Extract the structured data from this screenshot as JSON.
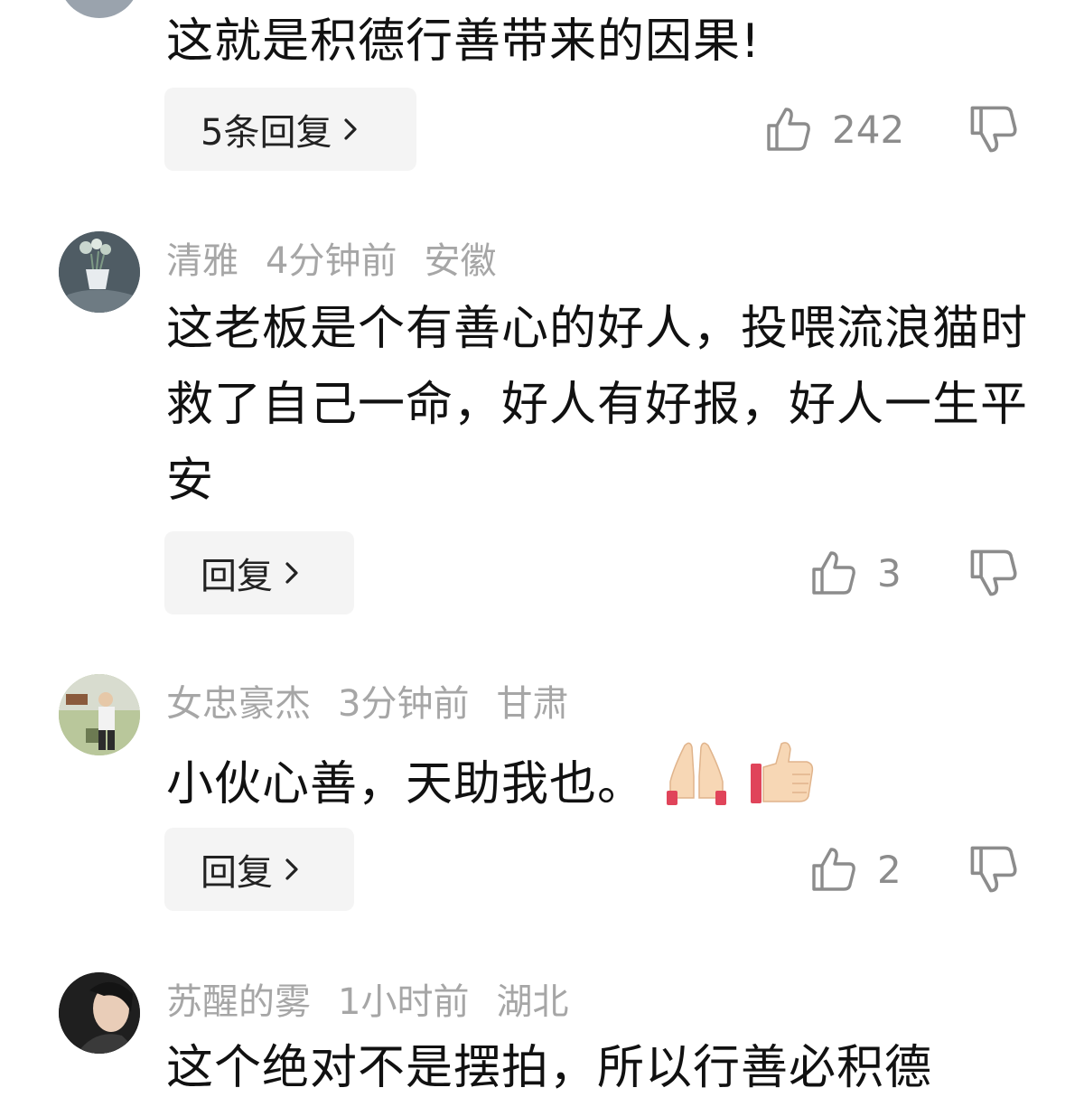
{
  "comments": [
    {
      "text": "这就是积德行善带来的因果!",
      "reply_label": "5条回复",
      "likes": "242"
    },
    {
      "user": "清雅",
      "time": "4分钟前",
      "location": "安徽",
      "text": "这老板是个有善心的好人，投喂流浪猫时救了自己一命，好人有好报，好人一生平安",
      "reply_label": "回复",
      "likes": "3"
    },
    {
      "user": "女忠豪杰",
      "time": "3分钟前",
      "location": "甘肃",
      "text": "小伙心善，天助我也。",
      "emojis": [
        "folded-hands",
        "thumbs-up"
      ],
      "reply_label": "回复",
      "likes": "2"
    },
    {
      "user": "苏醒的雾",
      "time": "1小时前",
      "location": "湖北",
      "text": "这个绝对不是摆拍，所以行善必积德"
    }
  ],
  "icons": {
    "like": "thumbs-up-outline-icon",
    "dislike": "thumbs-down-outline-icon",
    "chevron": "chevron-right-icon"
  },
  "colors": {
    "meta_text": "#a6a6a6",
    "reply_bg": "#f4f4f4",
    "icon": "#8c8c8c"
  }
}
